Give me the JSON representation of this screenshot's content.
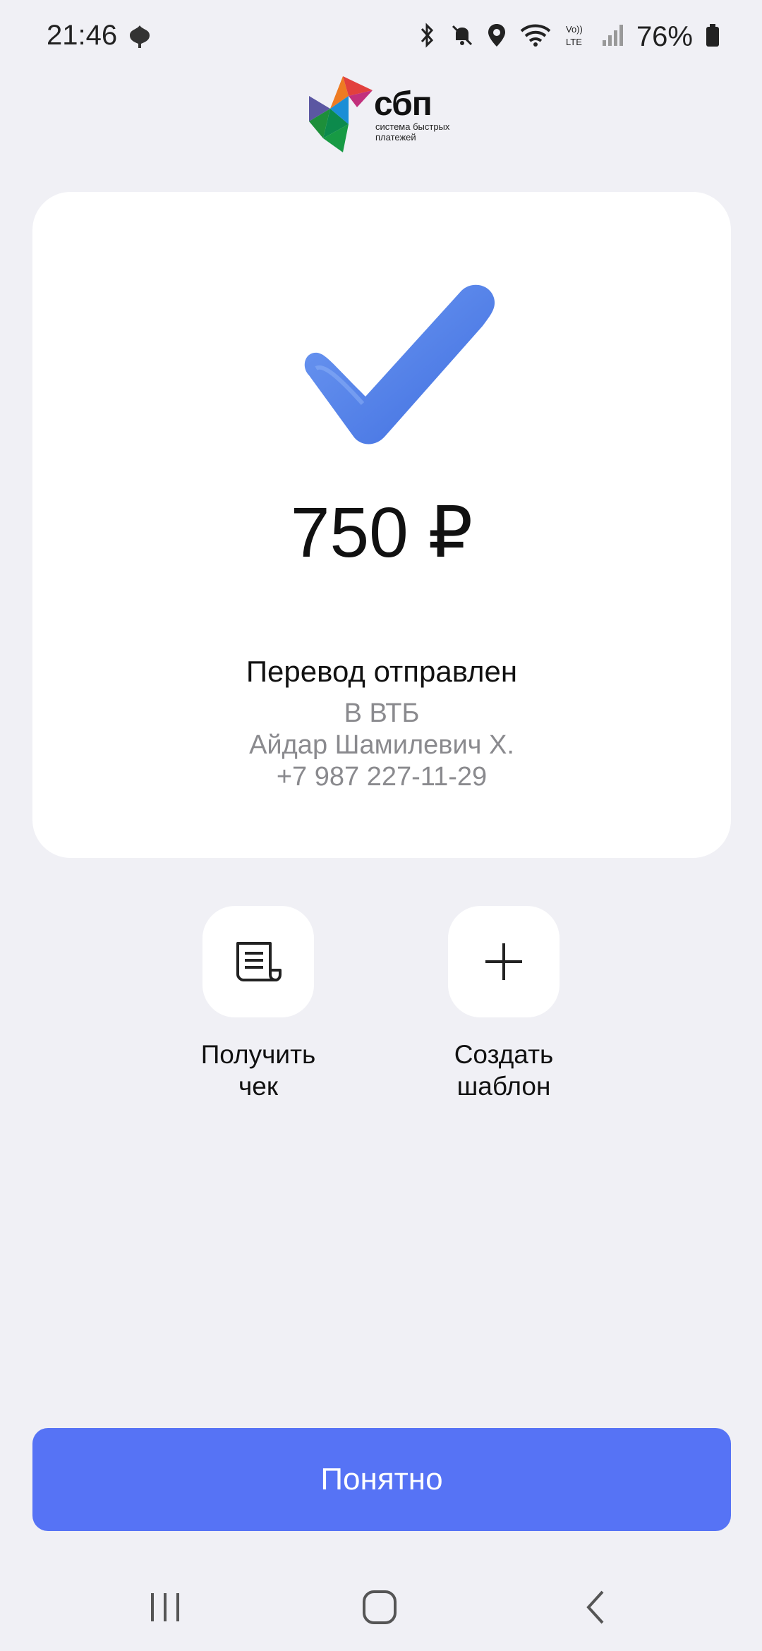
{
  "status_bar": {
    "time": "21:46",
    "battery": "76%",
    "icons": [
      "leaf-icon",
      "bluetooth-icon",
      "mute-icon",
      "location-icon",
      "wifi-icon",
      "volte-icon",
      "signal-icon",
      "battery-icon"
    ]
  },
  "logo": {
    "main": "сбп",
    "sub_line1": "система быстрых",
    "sub_line2": "платежей"
  },
  "payment": {
    "amount": "750 ₽",
    "status_title": "Перевод отправлен",
    "bank": "В ВТБ",
    "recipient": "Айдар Шамилевич Х.",
    "phone": "+7 987 227-11-29"
  },
  "actions": [
    {
      "line1": "Получить",
      "line2": "чек",
      "icon": "receipt-icon"
    },
    {
      "line1": "Создать",
      "line2": "шаблон",
      "icon": "plus-icon"
    }
  ],
  "primary_button": {
    "label": "Понятно"
  },
  "colors": {
    "accent": "#5673f5",
    "background": "#f0f0f5",
    "check": "#5b86e8"
  },
  "nav": [
    "recent-apps-icon",
    "home-icon",
    "back-icon"
  ]
}
